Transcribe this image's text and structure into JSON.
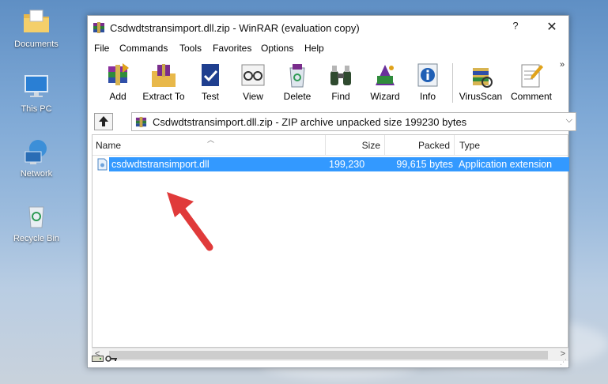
{
  "desktop": {
    "icons": [
      {
        "label": "Documents"
      },
      {
        "label": "This PC"
      },
      {
        "label": "Network"
      },
      {
        "label": "Recycle Bin"
      }
    ]
  },
  "window": {
    "title": "Csdwdtstransimport.dll.zip - WinRAR (evaluation copy)",
    "help_label": "?",
    "close_label": "✕"
  },
  "menu": {
    "file": "File",
    "commands": "Commands",
    "tools": "Tools",
    "favorites": "Favorites",
    "options": "Options",
    "help": "Help"
  },
  "toolbar": {
    "add": "Add",
    "extract": "Extract To",
    "test": "Test",
    "view": "View",
    "delete": "Delete",
    "find": "Find",
    "wizard": "Wizard",
    "info": "Info",
    "virusscan": "VirusScan",
    "comment": "Comment",
    "more": "»"
  },
  "address": {
    "path": "Csdwdtstransimport.dll.zip - ZIP archive unpacked size 199230 bytes",
    "dropdown": "⌵"
  },
  "list": {
    "columns": {
      "name": "Name",
      "size": "Size",
      "packed": "Packed",
      "type": "Type"
    },
    "rows": [
      {
        "name": "csdwdtstransimport.dll",
        "size": "199,230",
        "packed": "99,615 bytes",
        "type": "Application extension"
      }
    ]
  },
  "scroll": {
    "left": "<",
    "right": ">"
  },
  "colors": {
    "selection": "#3399ff",
    "annotation_arrow": "#e03a3a"
  }
}
